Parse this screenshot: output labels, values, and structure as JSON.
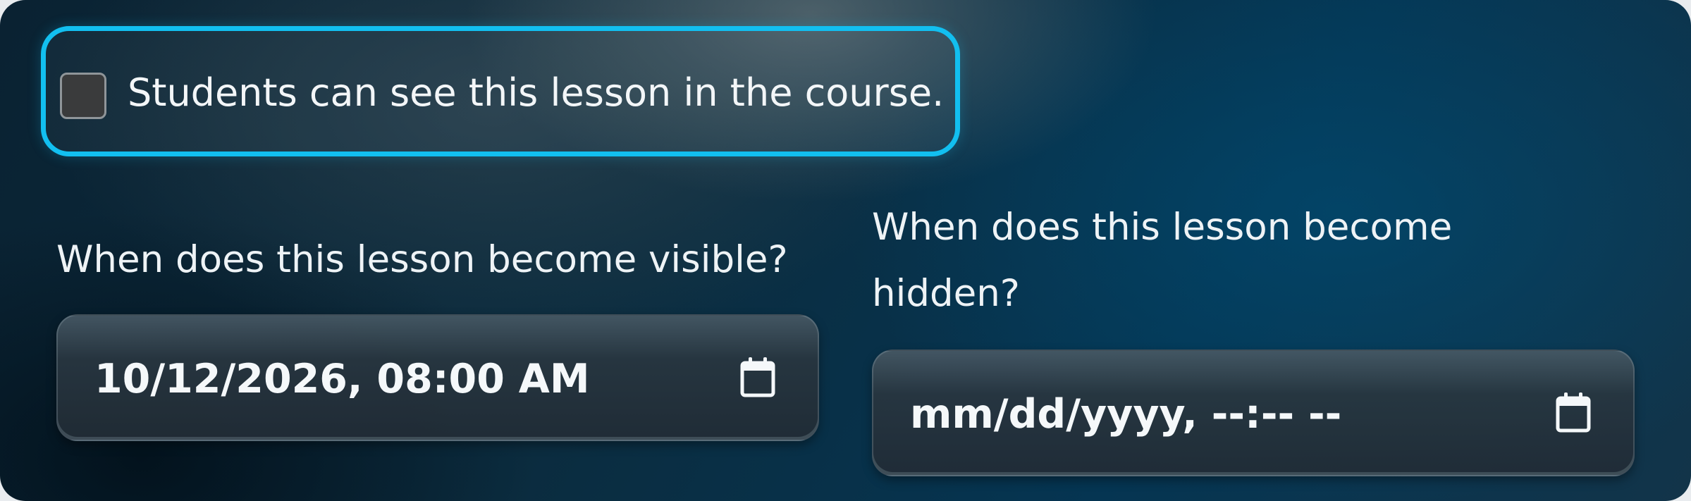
{
  "visibility": {
    "checkbox_checked": false,
    "label": "Students can see this lesson in the course."
  },
  "visible_from": {
    "label": "When does this lesson become visible?",
    "value": "10/12/2026, 08:00 AM",
    "icon": "calendar-icon"
  },
  "hidden_from": {
    "label": "When does this lesson become hidden?",
    "value": "mm/dd/yyyy, --:-- --",
    "icon": "calendar-icon"
  },
  "colors": {
    "focus_ring": "#12bff0",
    "text": "#f1f5f7"
  }
}
